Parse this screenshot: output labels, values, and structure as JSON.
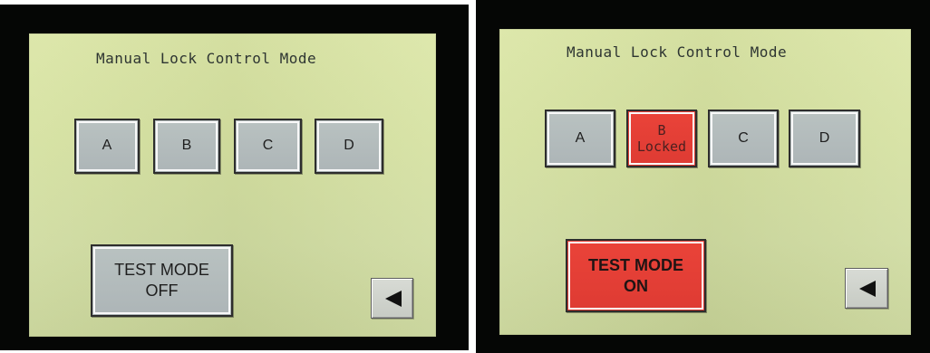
{
  "left_screen": {
    "title": "Manual Lock Control Mode",
    "lock_buttons": [
      {
        "label": "A"
      },
      {
        "label": "B"
      },
      {
        "label": "C"
      },
      {
        "label": "D"
      }
    ],
    "test_mode": {
      "line1": "TEST MODE",
      "line2": "OFF"
    },
    "back_icon": "left-triangle-icon"
  },
  "right_screen": {
    "title": "Manual Lock Control Mode",
    "lock_buttons": [
      {
        "label": "A"
      },
      {
        "label": "B",
        "status": "Locked",
        "color": "#e43f35"
      },
      {
        "label": "C"
      },
      {
        "label": "D"
      }
    ],
    "test_mode": {
      "line1": "TEST MODE",
      "line2": "ON",
      "color": "#e43f35"
    },
    "back_icon": "left-triangle-icon"
  },
  "colors": {
    "screen_background": "#d5e1a0",
    "normal_button": "#b4bcbd",
    "active_button": "#e43f35",
    "text": "#1e1e1e"
  }
}
